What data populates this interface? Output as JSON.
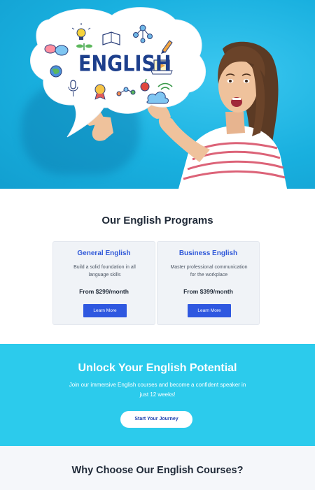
{
  "hero": {
    "bubble_text": "ENGLISH",
    "colors": {
      "background": "#1fb6e3",
      "bubble": "#ffffff",
      "title": "#1d3f8c"
    },
    "icons": [
      "lightbulb-icon",
      "book-icon",
      "network-icon",
      "pencil-icon",
      "chat-icon",
      "globe-icon",
      "laptop-icon",
      "microphone-icon",
      "award-icon",
      "molecule-icon",
      "apple-icon",
      "wifi-icon",
      "cloud-icon",
      "plant-icon"
    ]
  },
  "programs": {
    "title": "Our English Programs",
    "cards": [
      {
        "title": "General English",
        "description": "Build a solid foundation in all language skills",
        "price": "From $299/month",
        "button": "Learn More"
      },
      {
        "title": "Business English",
        "description": "Master professional communication for the workplace",
        "price": "From $399/month",
        "button": "Learn More"
      }
    ]
  },
  "cta": {
    "title": "Unlock Your English Potential",
    "text": "Join our immersive English courses and become a confident speaker in just 12 weeks!",
    "button": "Start Your Journey",
    "color": "#2ccbec"
  },
  "why": {
    "title": "Why Choose Our English Courses?"
  },
  "colors": {
    "accent": "#2f58e0",
    "card_bg": "#f0f3f7"
  }
}
